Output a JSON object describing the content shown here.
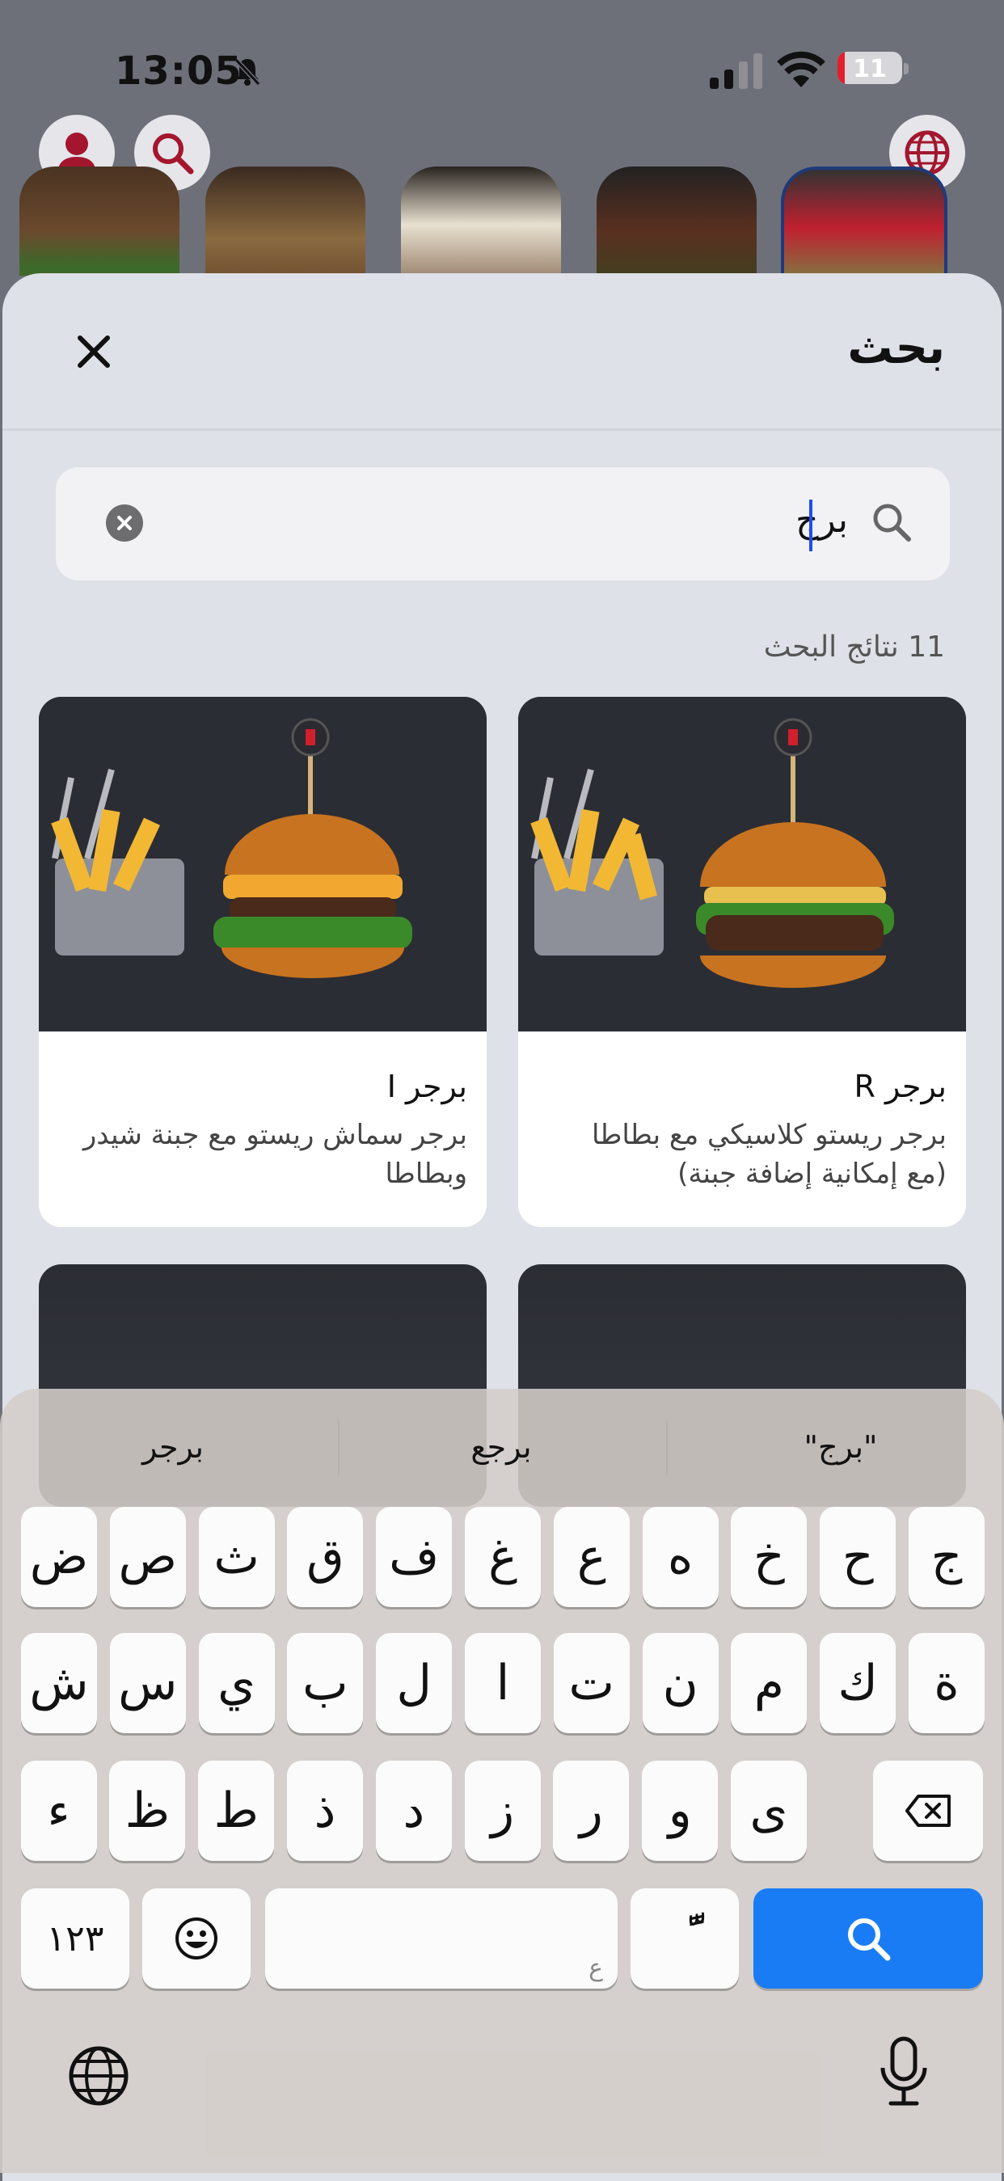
{
  "status_bar": {
    "time": "13:05",
    "battery": "11",
    "battery_level": 0.11
  },
  "search_sheet": {
    "title": "بحث",
    "query": "برج",
    "results_count": "11 نتائج البحث"
  },
  "results": [
    {
      "name": "برجر R",
      "desc_line1": "برجر ريستو كلاسيكي مع بطاطا",
      "desc_line2": "(مع إمكانية إضافة جبنة)"
    },
    {
      "name": "برجر I",
      "desc_line1": "برجر سماش ريستو مع جبنة شيدر",
      "desc_line2": "وبطاطا"
    }
  ],
  "keyboard": {
    "suggestions": [
      "\"برج\"",
      "برجع",
      "برجر"
    ],
    "row1": [
      "ج",
      "ح",
      "خ",
      "ه",
      "ع",
      "غ",
      "ف",
      "ق",
      "ث",
      "ص",
      "ض"
    ],
    "row2": [
      "ة",
      "ك",
      "م",
      "ن",
      "ت",
      "ا",
      "ل",
      "ب",
      "ي",
      "س",
      "ش"
    ],
    "row3": [
      "ى",
      "و",
      "ر",
      "ز",
      "د",
      "ذ",
      "ط",
      "ظ",
      "ء"
    ],
    "numbers_key": "١٢٣",
    "space_hint": "ع",
    "diacritic_key": "ًّ"
  },
  "icons": [
    "bell-slash-icon",
    "signal-icon",
    "wifi-icon",
    "user-icon",
    "search-icon",
    "globe-icon",
    "close-icon",
    "clear-icon",
    "backspace-icon",
    "emoji-icon",
    "mic-icon"
  ],
  "colors": {
    "brand": "#a3162e",
    "accent_blue": "#1a7cf5",
    "sheet_bg": "#dfe1e8"
  }
}
